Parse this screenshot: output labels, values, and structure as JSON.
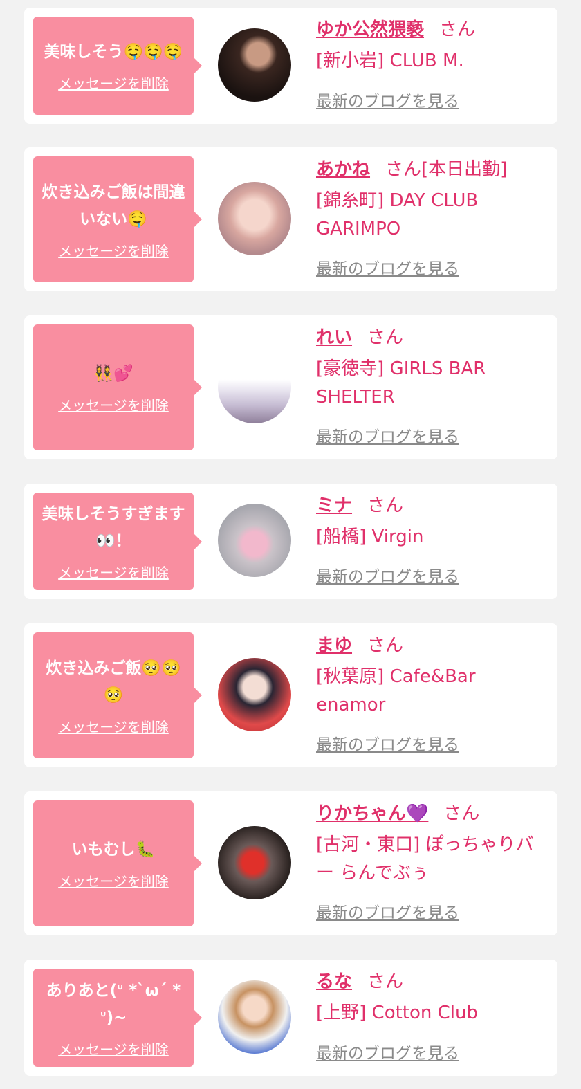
{
  "colors": {
    "page_background": "#f2f2f2",
    "card_background": "#ffffff",
    "bubble": "#f98ea0",
    "accent": "#e0306a",
    "link_gray": "#8a8a8a"
  },
  "suffix": "さん",
  "delete_label": "メッセージを削除",
  "blog_label": "最新のブログを見る",
  "items": [
    {
      "message": "美味しそう🤤🤤🤤",
      "name": "ゆか公然猥褻",
      "status": "",
      "shop": "[新小岩] CLUB M.",
      "avatar_icon": "photo-dark-hair"
    },
    {
      "message": "炊き込みご飯は間違いない🤤",
      "name": "あかね",
      "status": "[本日出勤]",
      "shop": "[錦糸町] DAY CLUB GARIMPO",
      "avatar_icon": "photo-selfie"
    },
    {
      "message": "👯‍♀️💕",
      "name": "れい",
      "status": "",
      "shop": "[豪徳寺] GIRLS BAR SHELTER",
      "avatar_icon": "photo-castle"
    },
    {
      "message": "美味しそうすぎます👀！",
      "name": "ミナ",
      "status": "",
      "shop": "[船橋] Virgin",
      "avatar_icon": "photo-heart-bunny"
    },
    {
      "message": "炊き込みご飯🥺🥺🥺",
      "name": "まゆ",
      "status": "",
      "shop": "[秋葉原] Cafe&Bar enamor",
      "avatar_icon": "photo-uniform"
    },
    {
      "message": "いもむし🐛",
      "name": "りかちゃん💜",
      "status": "",
      "shop": "[古河・東口] ぽっちゃりバー らんでぶぅ",
      "avatar_icon": "photo-heart-face"
    },
    {
      "message": "ありあと(ᐡ *`ω´ * ᐡ)~",
      "name": "るな",
      "status": "",
      "shop": "[上野] Cotton Club",
      "avatar_icon": "photo-blue-dress"
    }
  ]
}
